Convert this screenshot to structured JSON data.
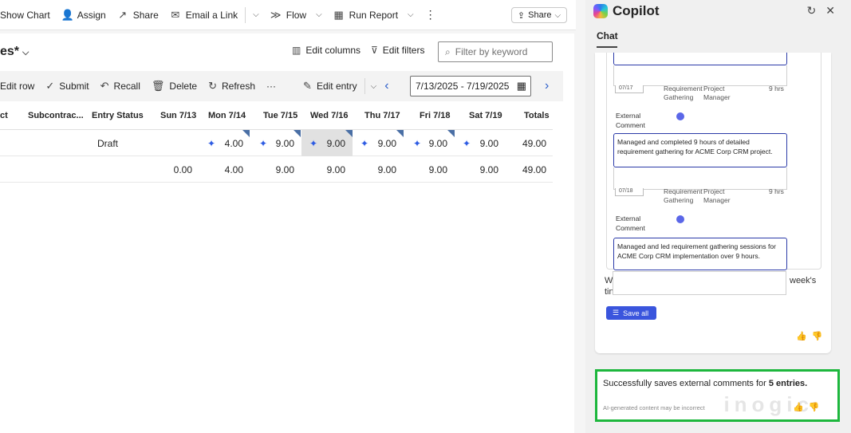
{
  "command_bar": {
    "show_chart": "Show Chart",
    "assign": "Assign",
    "share": "Share",
    "email_link": "Email a Link",
    "flow": "Flow",
    "run_report": "Run Report",
    "more": "⋮",
    "share_button": "Share"
  },
  "view": {
    "title": "es*",
    "edit_columns": "Edit columns",
    "edit_filters": "Edit filters",
    "filter_placeholder": "Filter by keyword"
  },
  "grid_toolbar": {
    "edit_row": "Edit row",
    "submit": "Submit",
    "recall": "Recall",
    "delete": "Delete",
    "refresh": "Refresh",
    "more": "···",
    "edit_entry": "Edit entry",
    "date_range": "7/13/2025 - 7/19/2025"
  },
  "grid": {
    "headers": [
      "ct",
      "Subcontrac...",
      "Entry Status",
      "Sun 7/13",
      "Mon 7/14",
      "Tue 7/15",
      "Wed 7/16",
      "Thu 7/17",
      "Fri 7/18",
      "Sat 7/19",
      "Totals"
    ],
    "row1": {
      "status": "Draft",
      "sun": "",
      "mon": "4.00",
      "tue": "9.00",
      "wed": "9.00",
      "thu": "9.00",
      "fri": "9.00",
      "sat": "9.00",
      "total": "49.00"
    },
    "row2": {
      "sun": "0.00",
      "mon": "4.00",
      "tue": "9.00",
      "wed": "9.00",
      "thu": "9.00",
      "fri": "9.00",
      "sat": "9.00",
      "total": "49.00"
    }
  },
  "copilot": {
    "title": "Copilot",
    "tab": "Chat",
    "entries": [
      {
        "date": "07/17",
        "task": "Requirement Gathering",
        "role": "Project Manager",
        "hours": "9 hrs",
        "label": "External Comment",
        "comment": "Managed and completed 9 hours of detailed requirement gathering for ACME Corp CRM project."
      },
      {
        "date": "07/18",
        "task": "Requirement Gathering",
        "role": "Project Manager",
        "hours": "9 hrs",
        "label": "External Comment",
        "comment": "Managed and led requirement gathering sessions for ACME Corp CRM implementation over 9 hours."
      }
    ],
    "partial_left": "We",
    "partial_left2": "tin",
    "partial_right": "week's",
    "save_all": "Save all",
    "result_prefix": "Successfully saves external comments for ",
    "result_bold": "5 entries.",
    "disclaimer": "AI-generated content may be incorrect",
    "watermark": "inogic"
  }
}
